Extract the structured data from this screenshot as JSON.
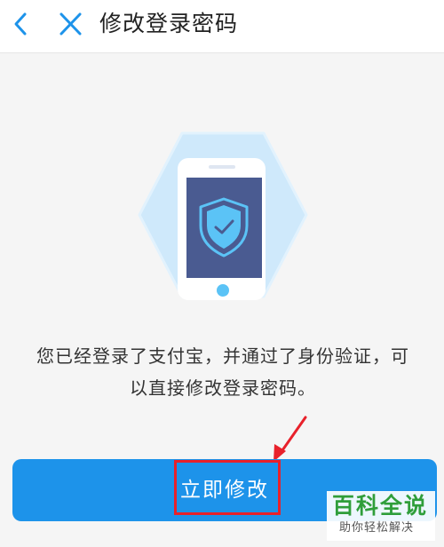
{
  "header": {
    "title": "修改登录密码",
    "back_icon": "chevron-left-icon",
    "close_icon": "close-icon"
  },
  "illustration": {
    "icon": "shield-check-icon"
  },
  "message": {
    "line1": "您已经登录了支付宝，并通过了身份验证，可",
    "line2": "以直接修改登录密码。"
  },
  "action": {
    "label": "立即修改"
  },
  "watermark": {
    "main": "百科全说",
    "sub": "助你轻松解决"
  },
  "colors": {
    "accent": "#1d93ea",
    "annotation": "#e8212b",
    "hexagon": "#cfe9fb",
    "phone_screen": "#4a5b91",
    "watermark_text": "#2f9e3a"
  }
}
